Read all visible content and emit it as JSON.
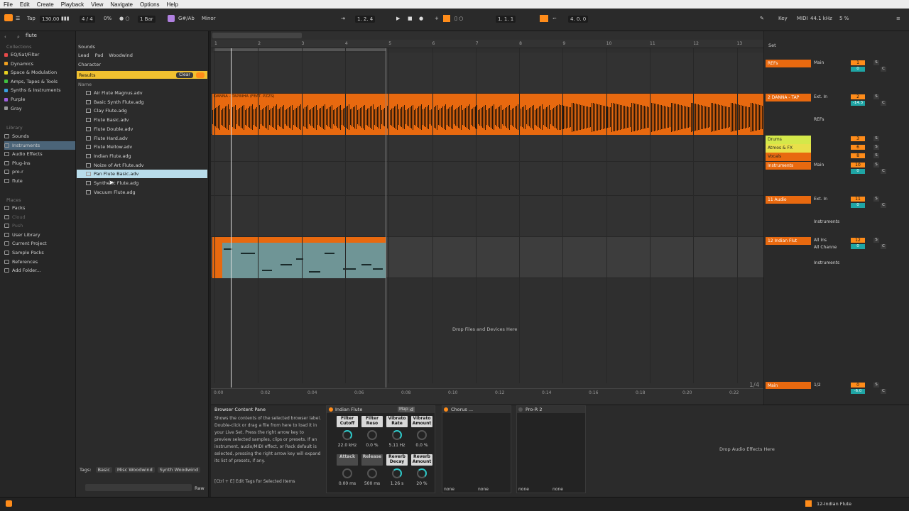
{
  "menu": [
    "File",
    "Edit",
    "Create",
    "Playback",
    "View",
    "Navigate",
    "Options",
    "Help"
  ],
  "transport": {
    "tap": "Tap",
    "tempo": "130.00",
    "meter": "4 / 4",
    "cpu": "0%",
    "quantize": "1 Bar",
    "key": "G#/Ab",
    "scale": "Minor",
    "position": "1. 2. 4",
    "loop_start": "1. 1. 1",
    "loop_len": "4. 0. 0",
    "key_label": "Key",
    "midi_label": "MIDI",
    "sample_rate": "44.1 kHz",
    "cpu_load": "5 %"
  },
  "browser": {
    "search_value": "flute",
    "collections_head": "Collections",
    "collections": [
      {
        "label": "EQ/Sat/Filter",
        "color": "#e84a4a"
      },
      {
        "label": "Dynamics",
        "color": "#f0a020"
      },
      {
        "label": "Space & Modulation",
        "color": "#e8d020"
      },
      {
        "label": "Amps, Tapes & Tools",
        "color": "#40c040"
      },
      {
        "label": "Synths & Instruments",
        "color": "#3aa0e0"
      },
      {
        "label": "Purple",
        "color": "#a060e0"
      },
      {
        "label": "Gray",
        "color": "#999999"
      }
    ],
    "library_head": "Library",
    "library": [
      "Sounds",
      "Instruments",
      "Audio Effects",
      "Plug-ins",
      "pro-r",
      "flute"
    ],
    "places_head": "Places",
    "places": [
      "Packs",
      "Cloud",
      "Push",
      "User Library",
      "Current Project",
      "Sample Packs",
      "References",
      "Add Folder..."
    ],
    "filter_head": "Sounds",
    "filter_tags": [
      "Lead",
      "Pad",
      "Woodwind"
    ],
    "character": "Character",
    "results": "Results",
    "clear": "Clear",
    "name_col": "Name",
    "files": [
      "Air Flute Magnus.adv",
      "Basic Synth Flute.adg",
      "Clay Flute.adg",
      "Flute Basic.adv",
      "Flute Double.adv",
      "Flute Hard.adv",
      "Flute Mellow.adv",
      "Indian Flute.adg",
      "Noize of Art Flute.adv",
      "Pan Flute Basic.adv",
      "Synthetic Flute.adg",
      "Vacuum Flute.adg"
    ],
    "selected_index": 9,
    "tags_label": "Tags:",
    "tags": [
      "Basic",
      "Misc Woodwind",
      "Synth Woodwind"
    ],
    "raw": "Raw"
  },
  "arrangement": {
    "bars": [
      "1",
      "2",
      "3",
      "4",
      "5",
      "6",
      "7",
      "8",
      "9",
      "10",
      "11",
      "12",
      "13"
    ],
    "clip_name": "DANNA - TAPINHA (FEAT. PZZS)",
    "drop_hint": "Drop Files and Devices Here",
    "zoom": "1/4",
    "time_marks": [
      "0:00",
      "0:02",
      "0:04",
      "0:06",
      "0:08",
      "0:10",
      "0:12",
      "0:14",
      "0:16",
      "0:18",
      "0:20",
      "0:22"
    ],
    "set_label": "Set"
  },
  "tracks": [
    {
      "name": "REFs",
      "io": "Main",
      "num": "1",
      "vol": "0"
    },
    {
      "name": "2 DANNA - TAP",
      "io": "Ext. In",
      "num": "2",
      "vol": "-14.3",
      "route": "REFs"
    },
    {
      "name": "Drums",
      "io": "",
      "num": "3",
      "vol": ""
    },
    {
      "name": "Atmos & FX",
      "io": "",
      "num": "6",
      "vol": ""
    },
    {
      "name": "Vocals",
      "io": "",
      "num": "8",
      "vol": ""
    },
    {
      "name": "Instruments",
      "io": "Main",
      "num": "10",
      "vol": "0"
    },
    {
      "name": "11 Audio",
      "io": "Ext. In",
      "num": "11",
      "vol": "0",
      "route": "Instruments"
    },
    {
      "name": "12 Indian Flut",
      "io": "All Ins",
      "num": "12",
      "vol": "0",
      "route": "Instruments",
      "channel": "All Channe"
    },
    {
      "name": "Main",
      "io": "1/2",
      "num": "0",
      "vol": "-6.0"
    }
  ],
  "info": {
    "title": "Browser Content Pane",
    "body": "Shows the contents of the selected browser label. Double-click or drag a file from here to load it in your Live Set. Press the right arrow key to preview selected samples, clips or presets. If an instrument, audio/MIDI effect, or Rack default is selected, pressing the right arrow key will expand its list of presets, if any.",
    "hint": "[Ctrl + E] Edit Tags for Selected Items"
  },
  "devices": {
    "rack_name": "Indian Flute",
    "rand": "Rand",
    "map": "Map",
    "macros": [
      {
        "label": "Filter Cutoff",
        "value": "22.0 kHz"
      },
      {
        "label": "Filter Reso",
        "value": "0.0 %"
      },
      {
        "label": "Vibrato Rate",
        "value": "5.11 Hz"
      },
      {
        "label": "Vibrato Amount",
        "value": "0.0 %"
      },
      {
        "label": "Attack",
        "value": "0.00 ms"
      },
      {
        "label": "Release",
        "value": "500 ms"
      },
      {
        "label": "Reverb Decay",
        "value": "1.26 s"
      },
      {
        "label": "Reverb Amount",
        "value": "20 %"
      }
    ],
    "chorus": "Chorus ...",
    "pror": "Pro-R 2",
    "none": "none",
    "drop_fx": "Drop Audio Effects Here"
  },
  "statusbar": {
    "track": "12-Indian Flute"
  }
}
